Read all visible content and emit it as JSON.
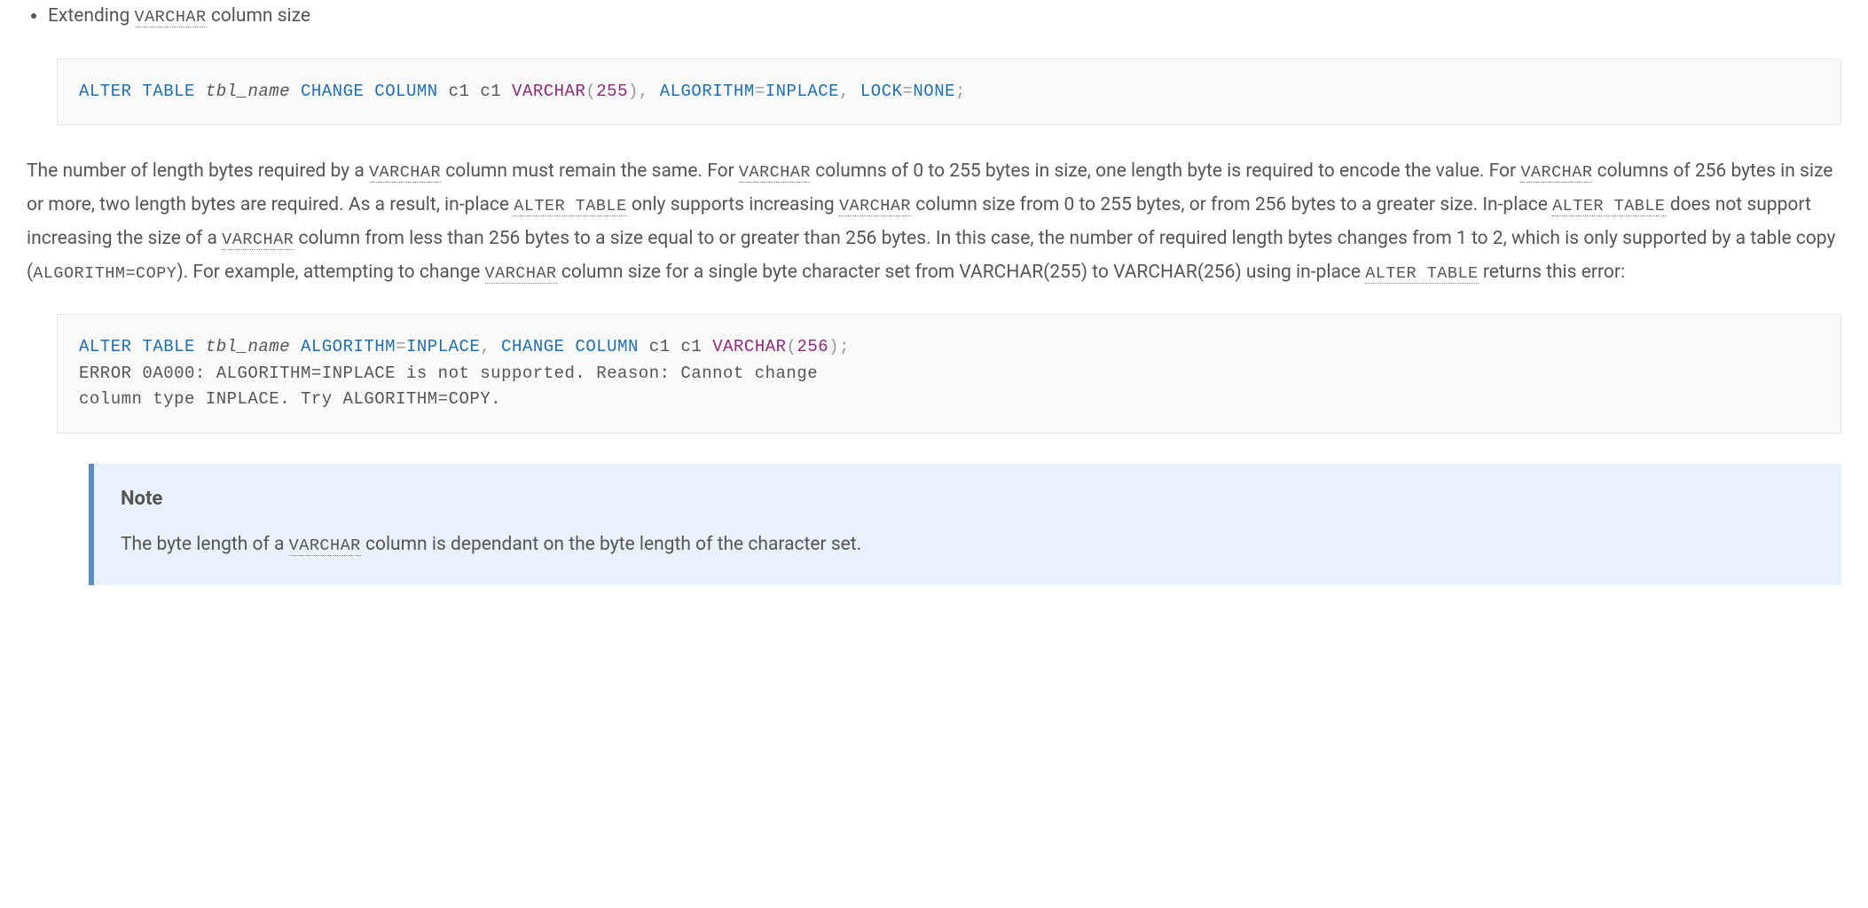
{
  "bullet": {
    "prefix": "Extending ",
    "code": "VARCHAR",
    "suffix": " column size"
  },
  "codeblock1": {
    "t1": "ALTER",
    "t2": "TABLE",
    "t3": "tbl_name",
    "t4": "CHANGE",
    "t5": "COLUMN",
    "t6": "c1 c1",
    "t7": "VARCHAR",
    "t8": "(",
    "t9": "255",
    "t10": ")",
    "t11": ",",
    "t12": "ALGORITHM",
    "t13": "=",
    "t14": "INPLACE",
    "t15": ",",
    "t16": "LOCK",
    "t17": "=",
    "t18": "NONE",
    "t19": ";"
  },
  "para1": {
    "s1": "The number of length bytes required by a ",
    "c1": "VARCHAR",
    "s2": " column must remain the same. For ",
    "c2": "VARCHAR",
    "s3": " columns of 0 to 255 bytes in size, one length byte is required to encode the value. For ",
    "c3": "VARCHAR",
    "s4": " columns of 256 bytes in size or more, two length bytes are required. As a result, in-place ",
    "c4": "ALTER TABLE",
    "s5": " only supports increasing ",
    "c5": "VARCHAR",
    "s6": " column size from 0 to 255 bytes, or from 256 bytes to a greater size. In-place ",
    "c6": "ALTER TABLE",
    "s7": " does not support increasing the size of a ",
    "c7": "VARCHAR",
    "s8": " column from less than 256 bytes to a size equal to or greater than 256 bytes. In this case, the number of required length bytes changes from 1 to 2, which is only supported by a table copy (",
    "c8": "ALGORITHM=COPY",
    "s9": "). For example, attempting to change ",
    "c9": "VARCHAR",
    "s10": " column size for a single byte character set from VARCHAR(255) to VARCHAR(256) using in-place ",
    "c10": "ALTER TABLE",
    "s11": " returns this error:"
  },
  "codeblock2": {
    "t1": "ALTER",
    "t2": "TABLE",
    "t3": "tbl_name",
    "t4": "ALGORITHM",
    "t5": "=",
    "t6": "INPLACE",
    "t7": ",",
    "t8": "CHANGE",
    "t9": "COLUMN",
    "t10": "c1 c1",
    "t11": "VARCHAR",
    "t12": "(",
    "t13": "256",
    "t14": ")",
    "t15": ";",
    "err": "ERROR 0A000: ALGORITHM=INPLACE is not supported. Reason: Cannot change\ncolumn type INPLACE. Try ALGORITHM=COPY."
  },
  "note": {
    "title": "Note",
    "s1": "The byte length of a ",
    "c1": "VARCHAR",
    "s2": " column is dependant on the byte length of the character set."
  }
}
